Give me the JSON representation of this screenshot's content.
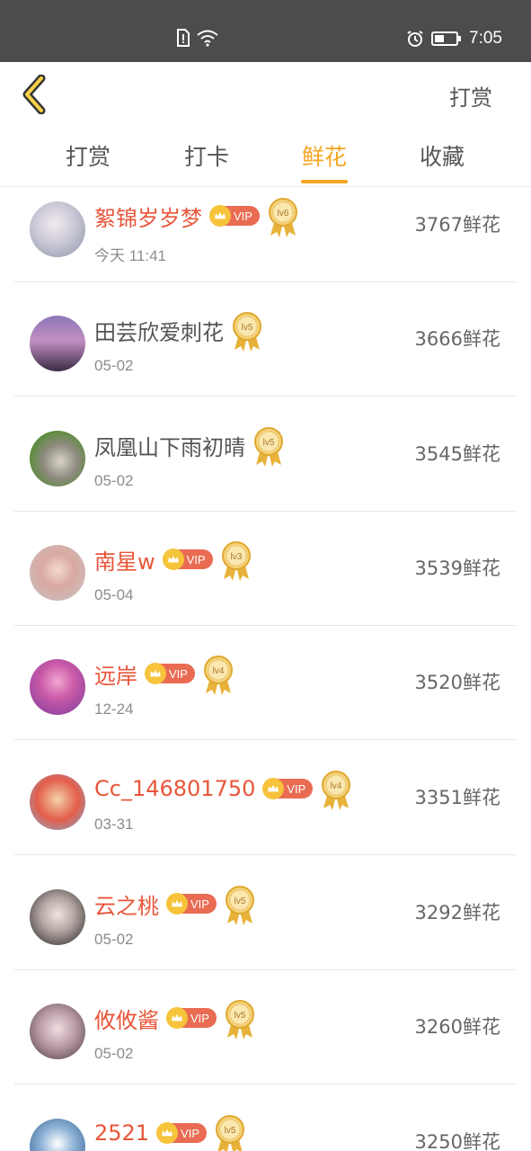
{
  "status_bar": {
    "time": "7:05"
  },
  "header": {
    "title": "打赏"
  },
  "tabs": [
    {
      "label": "打赏",
      "active": false
    },
    {
      "label": "打卡",
      "active": false
    },
    {
      "label": "鲜花",
      "active": true
    },
    {
      "label": "收藏",
      "active": false
    }
  ],
  "colors": {
    "accent": "#f5a623",
    "vip_name": "#e8563a",
    "vip_badge": "#e96b52",
    "status_bar": "#4c4c4c"
  },
  "list": [
    {
      "name": "絮锦岁岁梦",
      "vip": true,
      "level": "lv6",
      "date": "今天 11:41",
      "amount": "3767鲜花"
    },
    {
      "name": "田芸欣爱刺花",
      "vip": false,
      "level": "lv5",
      "date": "05-02",
      "amount": "3666鲜花"
    },
    {
      "name": "凤凰山下雨初晴",
      "vip": false,
      "level": "lv5",
      "date": "05-02",
      "amount": "3545鲜花"
    },
    {
      "name": "南星w",
      "vip": true,
      "level": "lv3",
      "date": "05-04",
      "amount": "3539鲜花"
    },
    {
      "name": "远岸",
      "vip": true,
      "level": "lv4",
      "date": "12-24",
      "amount": "3520鲜花"
    },
    {
      "name": "Cc_146801750",
      "vip": true,
      "level": "lv4",
      "date": "03-31",
      "amount": "3351鲜花"
    },
    {
      "name": "云之桃",
      "vip": true,
      "level": "lv5",
      "date": "05-02",
      "amount": "3292鲜花"
    },
    {
      "name": "攸攸酱",
      "vip": true,
      "level": "lv5",
      "date": "05-02",
      "amount": "3260鲜花"
    },
    {
      "name": "2521",
      "vip": true,
      "level": "lv5",
      "date": "",
      "amount": "3250鲜花"
    }
  ],
  "vip_label": "VIP"
}
